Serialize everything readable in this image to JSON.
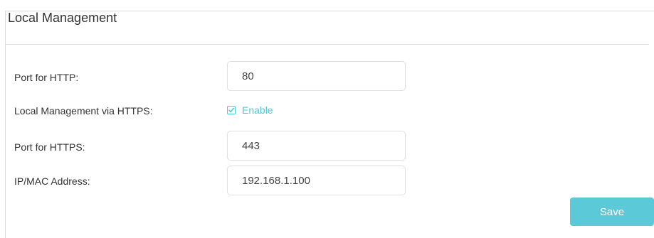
{
  "panel": {
    "title": "Local Management"
  },
  "form": {
    "http_port": {
      "label": "Port for HTTP:",
      "value": "80"
    },
    "https_management": {
      "label": "Local Management via HTTPS:",
      "checkbox_label": "Enable",
      "checked": true
    },
    "https_port": {
      "label": "Port for HTTPS:",
      "value": "443"
    },
    "ip_mac": {
      "label": "IP/MAC Address:",
      "value": "192.168.1.100"
    }
  },
  "actions": {
    "save_label": "Save"
  },
  "colors": {
    "accent": "#4acbd6",
    "button_bg": "#5cc9d8",
    "text": "#333333",
    "border": "#dfdfdf"
  },
  "icons": {
    "checkbox": "checkmark-icon"
  }
}
